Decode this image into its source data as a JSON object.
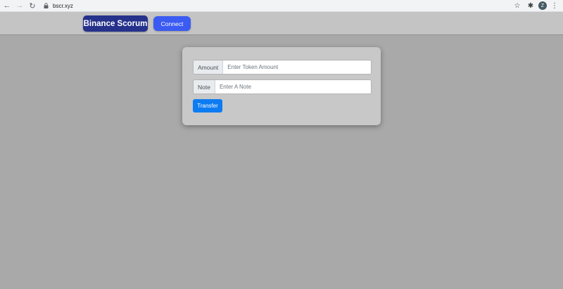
{
  "browser": {
    "url": "bscr.xyz",
    "profile_initial": "Z"
  },
  "header": {
    "brand": "Binance Scorum",
    "connect_label": "Connect"
  },
  "form": {
    "amount_label": "Amount",
    "amount_placeholder": "Enter Token Amount",
    "note_label": "Note",
    "note_placeholder": "Enter A Note",
    "transfer_label": "Transfer"
  },
  "colors": {
    "brand_bg": "#25318a",
    "connect_bg": "#3b5bf2",
    "transfer_bg": "#0d7cf2",
    "page_bg": "#a9a9a9"
  }
}
